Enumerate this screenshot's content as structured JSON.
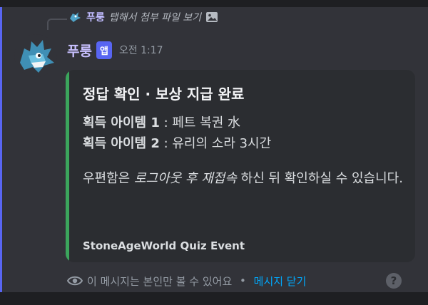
{
  "reply": {
    "username": "푸룽",
    "text": "탭해서 첨부 파일 보기",
    "icon": "image-icon"
  },
  "message": {
    "username": "푸룽",
    "app_tag": "앱",
    "timestamp": "오전 1:17"
  },
  "embed": {
    "accent_color": "#3ba55c",
    "title": "정답 확인 · 보상 지급 완료",
    "item1_label": "획득 아이템 1",
    "item1_value": " : 페트 복권 水",
    "item2_label": "획득 아이템 2",
    "item2_value": " : 유리의 소라 3시간",
    "note_prefix": "우편함은 ",
    "note_emphasis": "로그아웃 후 재접속",
    "note_suffix": " 하신 뒤 확인하실 수 있습니다.",
    "footer": "StoneAgeWorld Quiz Event"
  },
  "ephemeral": {
    "text": "이 메시지는 본인만 볼 수 있어요",
    "separator": " • ",
    "dismiss": "메시지 닫기"
  },
  "help": {
    "label": "?"
  }
}
